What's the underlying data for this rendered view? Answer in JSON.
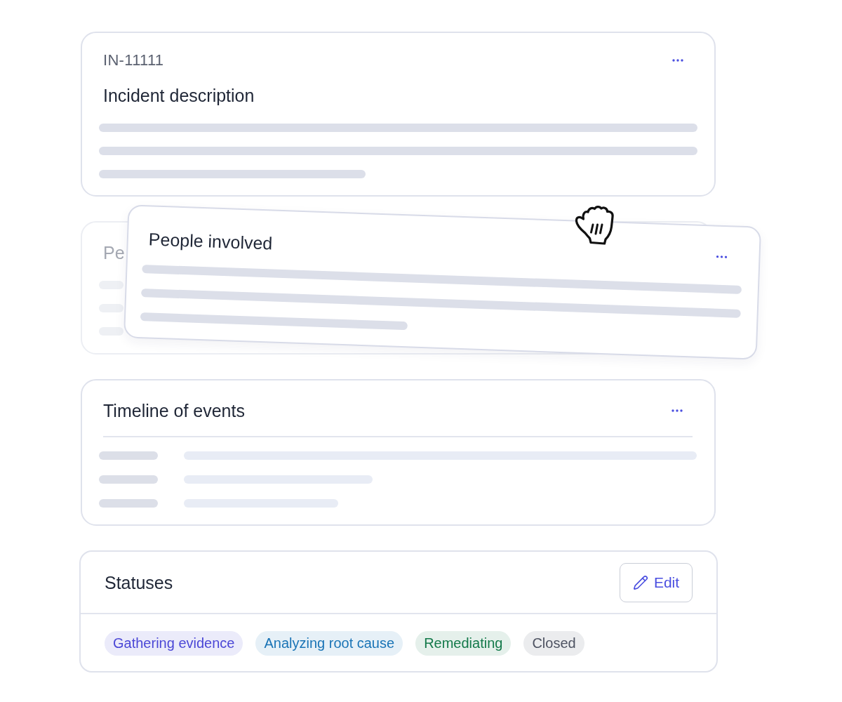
{
  "cards": [
    {
      "kind": "text",
      "id": "IN-11111",
      "title": "Incident description"
    },
    {
      "kind": "drop_placeholder",
      "title": "Pe",
      "dragged_card": {
        "title": "People involved"
      }
    },
    {
      "kind": "timeline",
      "title": "Timeline of events"
    }
  ],
  "statuses": {
    "title": "Statuses",
    "edit_button": "Edit",
    "tags": [
      {
        "label": "Gathering evidence",
        "color": "#4b47d6"
      },
      {
        "label": "Analyzing root cause",
        "color": "#1a74b6"
      },
      {
        "label": "Remediating",
        "color": "#13794a"
      },
      {
        "label": "Closed",
        "color": "#4d5261"
      }
    ]
  }
}
